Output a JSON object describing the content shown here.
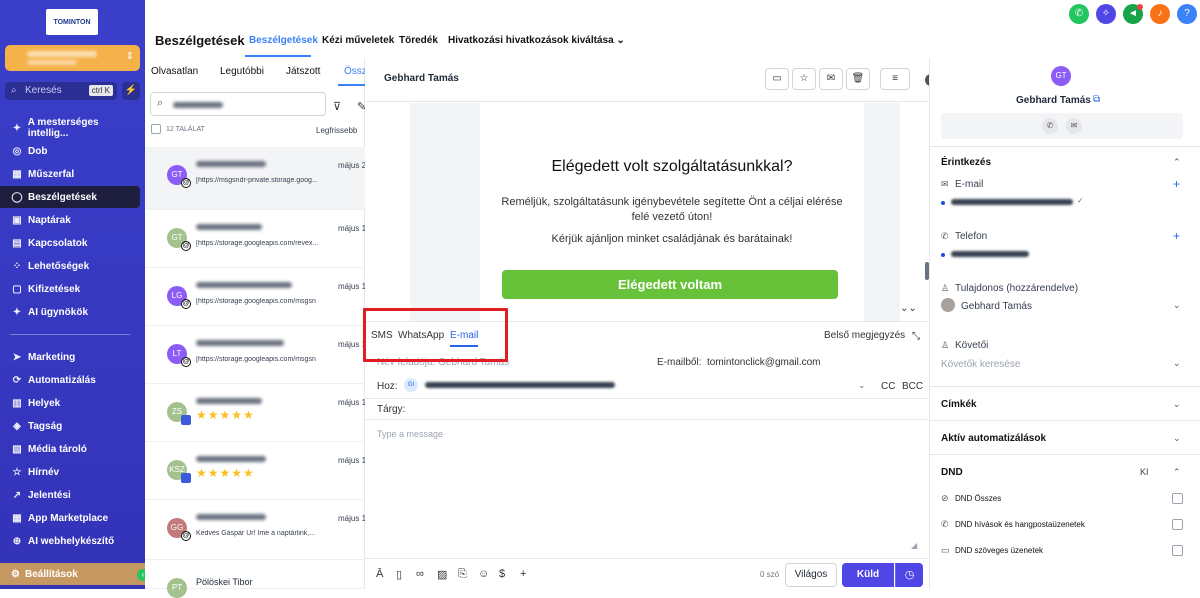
{
  "sidebar": {
    "logo": "TOMINTON",
    "search_label": "Keresés",
    "search_kbd": "ctrl K",
    "items": [
      {
        "label": "A mesterséges intellig...",
        "icon": "sparkle-icon",
        "glyph": "✦"
      },
      {
        "label": "Dob",
        "icon": "target-icon",
        "glyph": "◎"
      },
      {
        "label": "Műszerfal",
        "icon": "dashboard-icon",
        "glyph": "▦"
      },
      {
        "label": "Beszélgetések",
        "icon": "chat-icon",
        "glyph": "◯"
      },
      {
        "label": "Naptárak",
        "icon": "calendar-icon",
        "glyph": "▣"
      },
      {
        "label": "Kapcsolatok",
        "icon": "contacts-icon",
        "glyph": "▤"
      },
      {
        "label": "Lehetőségek",
        "icon": "opportunities-icon",
        "glyph": "⁘"
      },
      {
        "label": "Kifizetések",
        "icon": "payments-icon",
        "glyph": "▢"
      },
      {
        "label": "AI ügynökök",
        "icon": "ai-agent-icon",
        "glyph": "✦"
      },
      {
        "label": "Marketing",
        "icon": "send-icon",
        "glyph": "➤"
      },
      {
        "label": "Automatizálás",
        "icon": "automation-icon",
        "glyph": "⟳"
      },
      {
        "label": "Helyek",
        "icon": "sites-icon",
        "glyph": "▥"
      },
      {
        "label": "Tagság",
        "icon": "membership-icon",
        "glyph": "◈"
      },
      {
        "label": "Média tároló",
        "icon": "media-icon",
        "glyph": "▧"
      },
      {
        "label": "Hírnév",
        "icon": "star-icon",
        "glyph": "☆"
      },
      {
        "label": "Jelentési",
        "icon": "chart-icon",
        "glyph": "↗"
      },
      {
        "label": "App Marketplace",
        "icon": "apps-icon",
        "glyph": "▦"
      },
      {
        "label": "AI webhelykészítő",
        "icon": "globe-icon",
        "glyph": "⊕"
      }
    ],
    "settings": "Beállítások"
  },
  "header": {
    "title": "Beszélgetések",
    "tabs": [
      "Beszélgetések",
      "Kézi műveletek",
      "Töredék",
      "Hivatkozási hivatkozások kiváltása"
    ],
    "tab_chevron": "⌄"
  },
  "list": {
    "tabs": [
      "Olvasatlan",
      "Legutóbbi",
      "Játszott",
      "Össz"
    ],
    "count": "12 TALÁLAT",
    "sort": "Legfrissebb",
    "rows": [
      {
        "initials": "GT",
        "color": "#8b5cf6",
        "date": "május 2",
        "preview": "[https://msgsndr-private.storage.goog..."
      },
      {
        "initials": "GT",
        "color": "#a3c28e",
        "date": "május 1",
        "preview": "[https://storage.googleapis.com/revex..."
      },
      {
        "initials": "LG",
        "color": "#8b5cf6",
        "date": "május 1",
        "preview": "[https://storage.googleapis.com/msgsn"
      },
      {
        "initials": "LT",
        "color": "#8b5cf6",
        "date": "május 1",
        "preview": "[https://storage.googleapis.com/msgsn"
      },
      {
        "initials": "ZS",
        "color": "#a3c28e",
        "date": "május 1",
        "preview": "★★★★★"
      },
      {
        "initials": "KSZ",
        "color": "#a3c28e",
        "date": "május 1",
        "preview": "★★★★★"
      },
      {
        "initials": "GG",
        "color": "#c07a7a",
        "date": "május 1",
        "preview": "Kedves Gáspár Úr! Íme a naptárlink,..."
      },
      {
        "initials": "PT",
        "color": "#a3c28e",
        "date": "",
        "name": "Pölöskei Tibor",
        "preview": ""
      }
    ]
  },
  "conversation": {
    "name": "Gebhard Tamás",
    "email_heading": "Elégedett volt szolgáltatásunkkal?",
    "email_p1": "Reméljük, szolgáltatásunk igénybevétele segítette Önt a céljai elérése felé vezető úton!",
    "email_p2": "Kérjük ajánljon minket családjának és barátainak!",
    "email_button": "Elégedett voltam"
  },
  "composer": {
    "tabs": [
      "SMS",
      "WhatsApp",
      "E-mail"
    ],
    "internal_note": "Belső megjegyzés",
    "sender_name_label": "Név feladója: Gebhard Tamás",
    "from_label": "E-mailből:",
    "from_value": "tomintonclick@gmail.com",
    "to_label": "Hoz:",
    "to_avatar": "GI",
    "cc": "CC",
    "bcc": "BCC",
    "subject_label": "Tárgy:",
    "placeholder": "Type a message",
    "word_count": "0 szó",
    "theme_btn": "Világos",
    "send_btn": "Küld"
  },
  "contact": {
    "initials": "GT",
    "name": "Gebhard Tamás",
    "section_contact": "Érintkezés",
    "email_label": "E-mail",
    "phone_label": "Telefon",
    "owner_label": "Tulajdonos (hozzárendelve)",
    "owner_value": "Gebhard Tamás",
    "followers_label": "Követői",
    "followers_ph": "Követők keresése",
    "tags": "Címkék",
    "automations": "Aktív automatizálások",
    "dnd": "DND",
    "dnd_state": "KI",
    "dnd_items": [
      "DND Összes",
      "DND hívások és hangpostaüzenetek",
      "DND szöveges üzenetek"
    ]
  },
  "colors": {
    "sidebar": "#3a3fc9",
    "accent": "#4f46e5",
    "email_button": "#67c23a",
    "highlight": "#e11d24"
  }
}
